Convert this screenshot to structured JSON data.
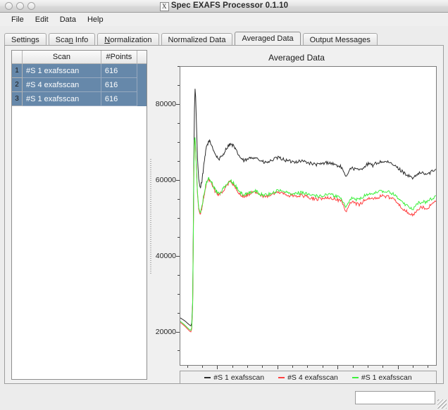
{
  "window": {
    "title": "Spec EXAFS Processor 0.1.10",
    "icon": "X",
    "buttons": [
      "close-button",
      "minimize-button",
      "zoom-button"
    ]
  },
  "menubar": {
    "items": [
      {
        "label": "File"
      },
      {
        "label": "Edit"
      },
      {
        "label": "Data"
      },
      {
        "label": "Help"
      }
    ]
  },
  "tabs": [
    {
      "label": "Settings",
      "active": false
    },
    {
      "label": "Scan Info",
      "active": false
    },
    {
      "label": "Normalization",
      "active": false
    },
    {
      "label": "Normalized Data",
      "active": false
    },
    {
      "label": "Averaged Data",
      "active": true
    },
    {
      "label": "Output Messages",
      "active": false
    }
  ],
  "scan_table": {
    "headers": [
      "",
      "Scan",
      "#Points"
    ],
    "rows": [
      {
        "index": "1",
        "scan": "#S 1  exafsscan",
        "points": "616",
        "selected": true
      },
      {
        "index": "2",
        "scan": "#S 4  exafsscan",
        "points": "616",
        "selected": true
      },
      {
        "index": "3",
        "scan": "#S 1  exafsscan",
        "points": "616",
        "selected": true
      }
    ]
  },
  "statusbar": {
    "field_value": "",
    "field_placeholder": ""
  },
  "chart_data": {
    "type": "line",
    "title": "Averaged Data",
    "xlabel": "",
    "ylabel": "",
    "xlim": [
      7.075,
      7.93
    ],
    "ylim": [
      11000,
      90000
    ],
    "grid": false,
    "legend_position": "bottom",
    "xticks": [
      7.2,
      7.4,
      7.6,
      7.8
    ],
    "xticks_minor_step": 0.05,
    "yticks": [
      20000,
      40000,
      60000,
      80000
    ],
    "yticks_minor_step": 5000,
    "series": [
      {
        "name": "#S 1  exafsscan",
        "color": "#2b2b2b",
        "x": [
          7.075,
          7.09,
          7.1,
          7.106,
          7.11,
          7.113,
          7.116,
          7.118,
          7.12,
          7.122,
          7.124,
          7.126,
          7.129,
          7.132,
          7.136,
          7.141,
          7.147,
          7.154,
          7.162,
          7.171,
          7.181,
          7.192,
          7.203,
          7.214,
          7.226,
          7.238,
          7.25,
          7.262,
          7.274,
          7.286,
          7.298,
          7.31,
          7.325,
          7.34,
          7.355,
          7.37,
          7.385,
          7.4,
          7.415,
          7.43,
          7.445,
          7.46,
          7.475,
          7.49,
          7.505,
          7.52,
          7.535,
          7.55,
          7.565,
          7.58,
          7.595,
          7.61,
          7.625,
          7.64,
          7.655,
          7.67,
          7.685,
          7.7,
          7.715,
          7.73,
          7.745,
          7.76,
          7.775,
          7.79,
          7.805,
          7.82,
          7.835,
          7.85,
          7.865,
          7.88,
          7.895,
          7.91,
          7.925
        ],
        "y": [
          23800,
          23000,
          22300,
          21900,
          21700,
          22400,
          28000,
          45000,
          66000,
          79000,
          84200,
          82000,
          74000,
          66000,
          60500,
          58000,
          60000,
          64500,
          69000,
          70500,
          69000,
          66800,
          65600,
          66400,
          68200,
          69600,
          69300,
          67700,
          66100,
          65200,
          65500,
          66100,
          66200,
          65300,
          64700,
          64900,
          65600,
          66000,
          65700,
          65200,
          65000,
          65000,
          65200,
          65000,
          64600,
          64300,
          64200,
          64500,
          64800,
          64500,
          64000,
          63600,
          60800,
          63400,
          63100,
          62700,
          63600,
          64400,
          64000,
          64700,
          65000,
          64900,
          64500,
          63800,
          62900,
          62000,
          61200,
          60500,
          61800,
          62000,
          61600,
          62300,
          63000
        ]
      },
      {
        "name": "#S 4  exafsscan",
        "color": "#ff4040",
        "x": [
          7.075,
          7.09,
          7.1,
          7.106,
          7.11,
          7.113,
          7.116,
          7.118,
          7.12,
          7.122,
          7.124,
          7.126,
          7.129,
          7.132,
          7.136,
          7.141,
          7.147,
          7.154,
          7.162,
          7.171,
          7.181,
          7.192,
          7.203,
          7.214,
          7.226,
          7.238,
          7.25,
          7.262,
          7.274,
          7.286,
          7.298,
          7.31,
          7.325,
          7.34,
          7.355,
          7.37,
          7.385,
          7.4,
          7.415,
          7.43,
          7.445,
          7.46,
          7.475,
          7.49,
          7.505,
          7.52,
          7.535,
          7.55,
          7.565,
          7.58,
          7.595,
          7.61,
          7.625,
          7.64,
          7.655,
          7.67,
          7.685,
          7.7,
          7.715,
          7.73,
          7.745,
          7.76,
          7.775,
          7.79,
          7.805,
          7.82,
          7.835,
          7.85,
          7.865,
          7.88,
          7.895,
          7.91,
          7.925
        ],
        "y": [
          22600,
          21600,
          20800,
          20300,
          20100,
          21000,
          27000,
          43000,
          62000,
          70200,
          71000,
          68000,
          62000,
          56500,
          52500,
          51000,
          52800,
          56200,
          59400,
          60200,
          58800,
          57000,
          56200,
          57000,
          58400,
          59600,
          59200,
          57800,
          56400,
          55800,
          56200,
          56700,
          56900,
          56100,
          55700,
          56000,
          56600,
          56900,
          56600,
          56200,
          56000,
          56000,
          56100,
          55900,
          55500,
          55200,
          55100,
          55400,
          55700,
          55400,
          54900,
          54600,
          51800,
          54400,
          54100,
          53700,
          54600,
          55400,
          55000,
          55600,
          55900,
          55800,
          55400,
          54700,
          53500,
          52300,
          51400,
          50800,
          52500,
          53000,
          52700,
          53600,
          54400
        ]
      },
      {
        "name": "#S 1  exafsscan",
        "color": "#3cf03c",
        "x": [
          7.075,
          7.09,
          7.1,
          7.106,
          7.11,
          7.113,
          7.116,
          7.118,
          7.12,
          7.122,
          7.124,
          7.126,
          7.129,
          7.132,
          7.136,
          7.141,
          7.147,
          7.154,
          7.162,
          7.171,
          7.181,
          7.192,
          7.203,
          7.214,
          7.226,
          7.238,
          7.25,
          7.262,
          7.274,
          7.286,
          7.298,
          7.31,
          7.325,
          7.34,
          7.355,
          7.37,
          7.385,
          7.4,
          7.415,
          7.43,
          7.445,
          7.46,
          7.475,
          7.49,
          7.505,
          7.52,
          7.535,
          7.55,
          7.565,
          7.58,
          7.595,
          7.61,
          7.625,
          7.64,
          7.655,
          7.67,
          7.685,
          7.7,
          7.715,
          7.73,
          7.745,
          7.76,
          7.775,
          7.79,
          7.805,
          7.82,
          7.835,
          7.85,
          7.865,
          7.88,
          7.895,
          7.91,
          7.925
        ],
        "y": [
          22900,
          21900,
          21100,
          20700,
          20500,
          21300,
          27300,
          43400,
          62400,
          70600,
          71400,
          68400,
          62400,
          56900,
          52900,
          51400,
          53200,
          56600,
          59800,
          60600,
          59200,
          57400,
          56600,
          57400,
          58800,
          60000,
          59600,
          58200,
          56800,
          56200,
          56600,
          57100,
          57300,
          56500,
          56100,
          56400,
          57000,
          57300,
          57100,
          56800,
          56600,
          56700,
          56800,
          56600,
          56300,
          56000,
          55900,
          56200,
          56500,
          56200,
          55800,
          55500,
          52800,
          55400,
          55200,
          54900,
          55800,
          56600,
          56300,
          56900,
          57200,
          57100,
          56800,
          56100,
          55000,
          53900,
          53000,
          52400,
          54000,
          54500,
          54300,
          55200,
          56000
        ]
      }
    ]
  }
}
